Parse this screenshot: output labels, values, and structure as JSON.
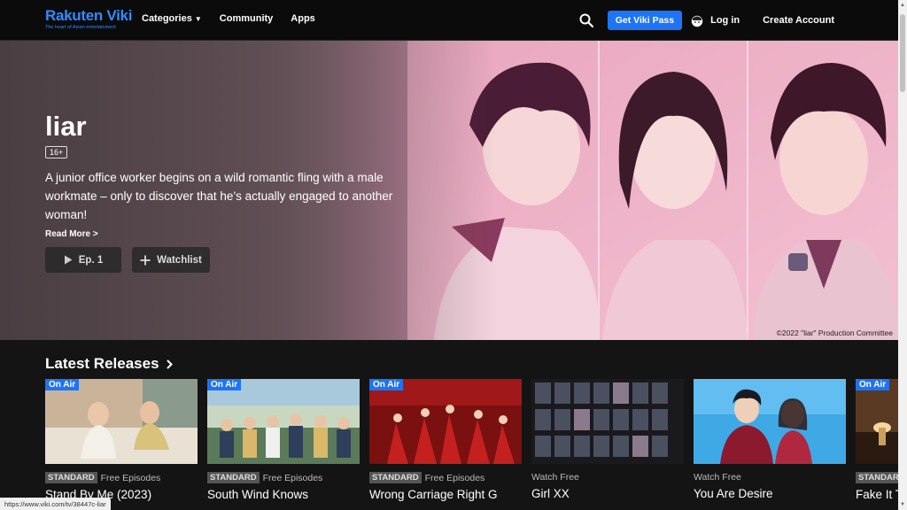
{
  "nav": {
    "logo_main": "Rakuten Viki",
    "logo_tag": "The heart of Asian entertainment",
    "categories": "Categories",
    "community": "Community",
    "apps": "Apps",
    "pass_button": "Get Viki Pass",
    "login": "Log in",
    "create_account": "Create Account"
  },
  "hero": {
    "title": "liar",
    "rating": "16+",
    "description": "A junior office worker begins on a wild romantic fling with a male workmate – only to discover that he’s actually engaged to another woman!",
    "read_more": "Read More >",
    "ep_button": "Ep. 1",
    "watchlist_button": "Watchlist",
    "copyright": "©2022 \"liar\" Production Committee"
  },
  "latest": {
    "title": "Latest Releases",
    "cards": [
      {
        "badge": "On Air",
        "tier": "STANDARD",
        "meta": "Free Episodes",
        "title": "Stand By Me (2023)"
      },
      {
        "badge": "On Air",
        "tier": "STANDARD",
        "meta": "Free Episodes",
        "title": "South Wind Knows"
      },
      {
        "badge": "On Air",
        "tier": "STANDARD",
        "meta": "Free Episodes",
        "title": "Wrong Carriage Right G"
      },
      {
        "badge": "",
        "tier": "",
        "meta": "Watch Free",
        "title": "Girl XX"
      },
      {
        "badge": "",
        "tier": "",
        "meta": "Watch Free",
        "title": "You Are Desire"
      },
      {
        "badge": "On Air",
        "tier": "STANDAR",
        "meta": "",
        "title": "Fake It T"
      }
    ]
  },
  "status_url": "https://www.viki.com/tv/38447c-liar",
  "colors": {
    "accent": "#1d74f5",
    "logo": "#2f8cff",
    "background": "#141414"
  }
}
